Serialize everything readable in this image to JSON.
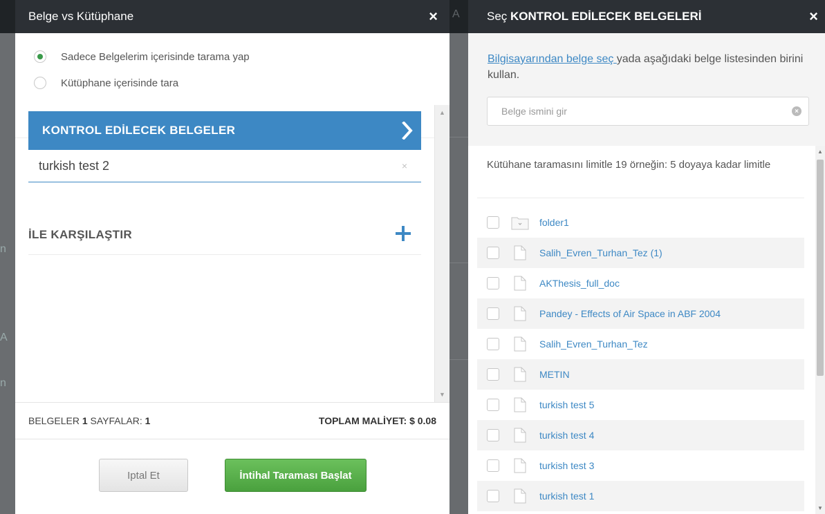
{
  "background": {
    "left_fragments": [
      "n",
      "A",
      "n"
    ],
    "gap_fragment": "A"
  },
  "left_modal": {
    "title": "Belge vs Kütüphane",
    "close": "×",
    "radio_options": [
      {
        "label": "Sadece Belgelerim içerisinde tarama yap",
        "selected": true
      },
      {
        "label": "Kütüphane içerisinde tara",
        "selected": false
      }
    ],
    "check_section_label": "KONTROL EDİLECEK BELGELER",
    "selected_document": "turkish test 2",
    "remove_symbol": "×",
    "compare_label": "İLE KARŞILAŞTIR",
    "footer": {
      "documents_label": "BELGELER",
      "documents_count": "1",
      "pages_label": "SAYFALAR:",
      "pages_count": "1",
      "cost_label": "TOPLAM MALİYET: $ 0.08"
    },
    "cancel_button": "Iptal Et",
    "start_button": "İntihal Taraması Başlat"
  },
  "right_modal": {
    "title_prefix": "Seç ",
    "title_bold": "KONTROL EDİLECEK BELGELERİ",
    "close": "×",
    "intro_link": "Bilgisayarından belge seç ",
    "intro_text": "yada aşağıdaki belge listesinden birini kullan.",
    "search_placeholder": "Belge ismini gir",
    "clear_symbol": "×",
    "limit_text": "Kütühane taramasını limitle 19 örneğin: 5 doyaya kadar limitle",
    "files": [
      {
        "name": "folder1",
        "type": "folder"
      },
      {
        "name": "Salih_Evren_Turhan_Tez (1)",
        "type": "file"
      },
      {
        "name": "AKThesis_full_doc",
        "type": "file"
      },
      {
        "name": "Pandey - Effects of Air Space in ABF 2004",
        "type": "file"
      },
      {
        "name": "Salih_Evren_Turhan_Tez",
        "type": "file"
      },
      {
        "name": "METIN",
        "type": "file"
      },
      {
        "name": "turkish test 5",
        "type": "file"
      },
      {
        "name": "turkish test 4",
        "type": "file"
      },
      {
        "name": "turkish test 3",
        "type": "file"
      },
      {
        "name": "turkish test 1",
        "type": "file"
      }
    ]
  },
  "colors": {
    "header_bg": "#2c3035",
    "accent_blue": "#3d88c4",
    "start_green": "#4aa13e",
    "radio_selected": "#3a9a4a"
  }
}
